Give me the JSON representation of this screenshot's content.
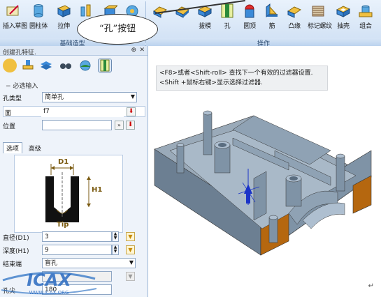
{
  "ribbon": {
    "tools": [
      {
        "label": "插入草图",
        "icon": "sketch-icon"
      },
      {
        "label": "圆柱体",
        "icon": "cylinder-icon"
      },
      {
        "label": "拉伸",
        "icon": "extrude-icon"
      },
      {
        "label": "",
        "icon": "revolve-icon"
      },
      {
        "label": "",
        "icon": "shape-icon"
      },
      {
        "label": "",
        "icon": "fillet-icon"
      },
      {
        "label": "",
        "icon": "chamfer-icon"
      },
      {
        "label": "",
        "icon": "shell-icon"
      },
      {
        "label": "拔模",
        "icon": "draft-icon"
      },
      {
        "label": "孔",
        "icon": "hole-icon"
      },
      {
        "label": "圆顶",
        "icon": "dome-icon"
      },
      {
        "label": "筋",
        "icon": "rib-icon"
      },
      {
        "label": "凸缘",
        "icon": "flange-icon"
      },
      {
        "label": "标记螺纹",
        "icon": "thread-icon"
      },
      {
        "label": "抽壳",
        "icon": "shell-cut-icon"
      },
      {
        "label": "组合",
        "icon": "combine-icon"
      }
    ],
    "group_basic": "基础造型",
    "group_ops": "操作"
  },
  "callout": {
    "text": "“孔”按钮"
  },
  "panel": {
    "title": "创建孔特征.",
    "section_required": "必选输入",
    "hole_type_label": "孔类型",
    "hole_type_value": "简单孔",
    "face_label": "面",
    "face_value": "f7",
    "position_label": "位置",
    "position_value": "",
    "tabs": [
      "选项",
      "高级"
    ],
    "diagram": {
      "d1": "D1",
      "h1": "H1",
      "tip": "Tip"
    },
    "diameter_label": "直径(D1)",
    "diameter_value": "3",
    "depth_label": "深度(H1)",
    "depth_value": "9",
    "end_label": "结束端",
    "end_value": "盲孔",
    "tip_label": "孔尖",
    "tip_value": "180"
  },
  "viewport": {
    "hint_line1": "<F8>或者<Shift-roll> 查找下一个有效的过滤器设置.",
    "hint_line2": "<Shift +鼠标右键>显示选择过滤器.",
    "enter_mark": "↵"
  },
  "watermark": {
    "text": "ICAX",
    "url": "WWW.ICAX.ORG"
  },
  "colors": {
    "part_body": "#7f93a6",
    "part_highlight": "#aebfd0",
    "part_cut": "#b5670f",
    "ribbon_bg": "#d8e6f7",
    "panel_bg": "#eef3fa",
    "axis_blue": "#1a33c8",
    "warning_red": "#c00000"
  }
}
